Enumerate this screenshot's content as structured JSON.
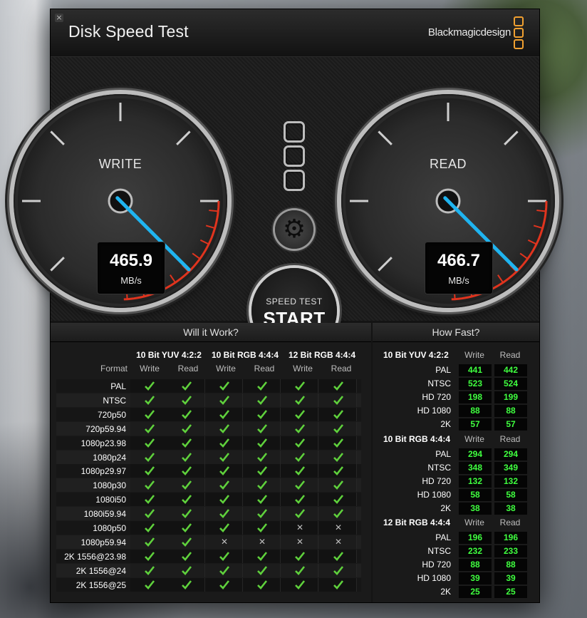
{
  "window": {
    "close_glyph": "×",
    "title": "Disk Speed Test",
    "brand": "Blackmagicdesign"
  },
  "gauges": {
    "write": {
      "label": "WRITE",
      "value": "465.9",
      "unit": "MB/s"
    },
    "read": {
      "label": "READ",
      "value": "466.7",
      "unit": "MB/s"
    }
  },
  "controls": {
    "speed_test": "SPEED TEST",
    "start": "START",
    "settings_icon": "gear-icon"
  },
  "will_it_work": {
    "title": "Will it Work?",
    "format_label": "Format",
    "groups": [
      "10 Bit YUV 4:2:2",
      "10 Bit RGB 4:4:4",
      "12 Bit RGB 4:4:4"
    ],
    "sub": [
      "Write",
      "Read"
    ],
    "rows": [
      {
        "format": "PAL",
        "ok": [
          1,
          1,
          1,
          1,
          1,
          1
        ]
      },
      {
        "format": "NTSC",
        "ok": [
          1,
          1,
          1,
          1,
          1,
          1
        ]
      },
      {
        "format": "720p50",
        "ok": [
          1,
          1,
          1,
          1,
          1,
          1
        ]
      },
      {
        "format": "720p59.94",
        "ok": [
          1,
          1,
          1,
          1,
          1,
          1
        ]
      },
      {
        "format": "1080p23.98",
        "ok": [
          1,
          1,
          1,
          1,
          1,
          1
        ]
      },
      {
        "format": "1080p24",
        "ok": [
          1,
          1,
          1,
          1,
          1,
          1
        ]
      },
      {
        "format": "1080p29.97",
        "ok": [
          1,
          1,
          1,
          1,
          1,
          1
        ]
      },
      {
        "format": "1080p30",
        "ok": [
          1,
          1,
          1,
          1,
          1,
          1
        ]
      },
      {
        "format": "1080i50",
        "ok": [
          1,
          1,
          1,
          1,
          1,
          1
        ]
      },
      {
        "format": "1080i59.94",
        "ok": [
          1,
          1,
          1,
          1,
          1,
          1
        ]
      },
      {
        "format": "1080p50",
        "ok": [
          1,
          1,
          1,
          1,
          0,
          0
        ]
      },
      {
        "format": "1080p59.94",
        "ok": [
          1,
          1,
          0,
          0,
          0,
          0
        ]
      },
      {
        "format": "2K 1556@23.98",
        "ok": [
          1,
          1,
          1,
          1,
          1,
          1
        ]
      },
      {
        "format": "2K 1556@24",
        "ok": [
          1,
          1,
          1,
          1,
          1,
          1
        ]
      },
      {
        "format": "2K 1556@25",
        "ok": [
          1,
          1,
          1,
          1,
          1,
          1
        ]
      }
    ],
    "x_glyph": "✕"
  },
  "how_fast": {
    "title": "How Fast?",
    "sub": [
      "Write",
      "Read"
    ],
    "groups": [
      {
        "name": "10 Bit YUV 4:2:2",
        "rows": [
          {
            "label": "PAL",
            "write": "441",
            "read": "442"
          },
          {
            "label": "NTSC",
            "write": "523",
            "read": "524"
          },
          {
            "label": "HD 720",
            "write": "198",
            "read": "199"
          },
          {
            "label": "HD 1080",
            "write": "88",
            "read": "88"
          },
          {
            "label": "2K",
            "write": "57",
            "read": "57"
          }
        ]
      },
      {
        "name": "10 Bit RGB 4:4:4",
        "rows": [
          {
            "label": "PAL",
            "write": "294",
            "read": "294"
          },
          {
            "label": "NTSC",
            "write": "348",
            "read": "349"
          },
          {
            "label": "HD 720",
            "write": "132",
            "read": "132"
          },
          {
            "label": "HD 1080",
            "write": "58",
            "read": "58"
          },
          {
            "label": "2K",
            "write": "38",
            "read": "38"
          }
        ]
      },
      {
        "name": "12 Bit RGB 4:4:4",
        "rows": [
          {
            "label": "PAL",
            "write": "196",
            "read": "196"
          },
          {
            "label": "NTSC",
            "write": "232",
            "read": "233"
          },
          {
            "label": "HD 720",
            "write": "88",
            "read": "88"
          },
          {
            "label": "HD 1080",
            "write": "39",
            "read": "39"
          },
          {
            "label": "2K",
            "write": "25",
            "read": "25"
          }
        ]
      }
    ]
  },
  "colors": {
    "accent": "#f0a030",
    "needle": "#1fb4f0",
    "redzone": "#e0341e",
    "value_green": "#3fff3f",
    "check_green": "#5fd13c"
  }
}
